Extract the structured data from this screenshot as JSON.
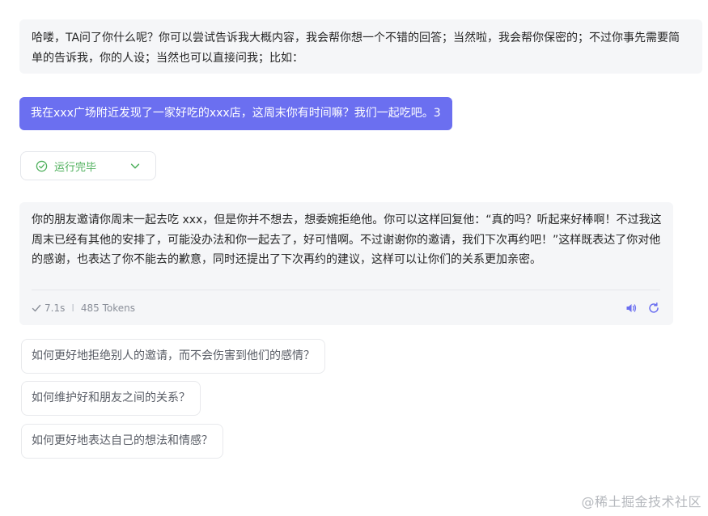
{
  "intro": {
    "text": "哈喽，TA问了你什么呢？你可以尝试告诉我大概内容，我会帮你想一个不错的回答；当然啦，我会帮你保密的；不过你事先需要简单的告诉我，你的人设；当然也可以直接问我；比如："
  },
  "user_message": {
    "text": "我在xxx广场附近发现了一家好吃的xxx店，这周末你有时间嘛？我们一起吃吧。3"
  },
  "run_status": {
    "label": "运行完毕",
    "status_icon": "check-circle-icon",
    "expand_icon": "chevron-down-icon",
    "color": "#4caf5a"
  },
  "answer": {
    "text": "你的朋友邀请你周末一起去吃 xxx，但是你并不想去，想委婉拒绝他。你可以这样回复他：“真的吗？听起来好棒啊！不过我这周末已经有其他的安排了，可能没办法和你一起去了，好可惜啊。不过谢谢你的邀请，我们下次再约吧！”这样既表达了你对他的感谢，也表达了你不能去的歉意，同时还提出了下次再约的建议，这样可以让你们的关系更加亲密。",
    "duration": "7.1s",
    "separator": "I",
    "tokens": "485 Tokens",
    "actions": [
      "speaker-icon",
      "refresh-icon"
    ],
    "accent": "#6b6ff0"
  },
  "suggestions": [
    "如何更好地拒绝别人的邀请，而不会伤害到他们的感情？",
    "如何维护好和朋友之间的关系？",
    "如何更好地表达自己的想法和情感？"
  ],
  "watermark": "@稀土掘金技术社区"
}
